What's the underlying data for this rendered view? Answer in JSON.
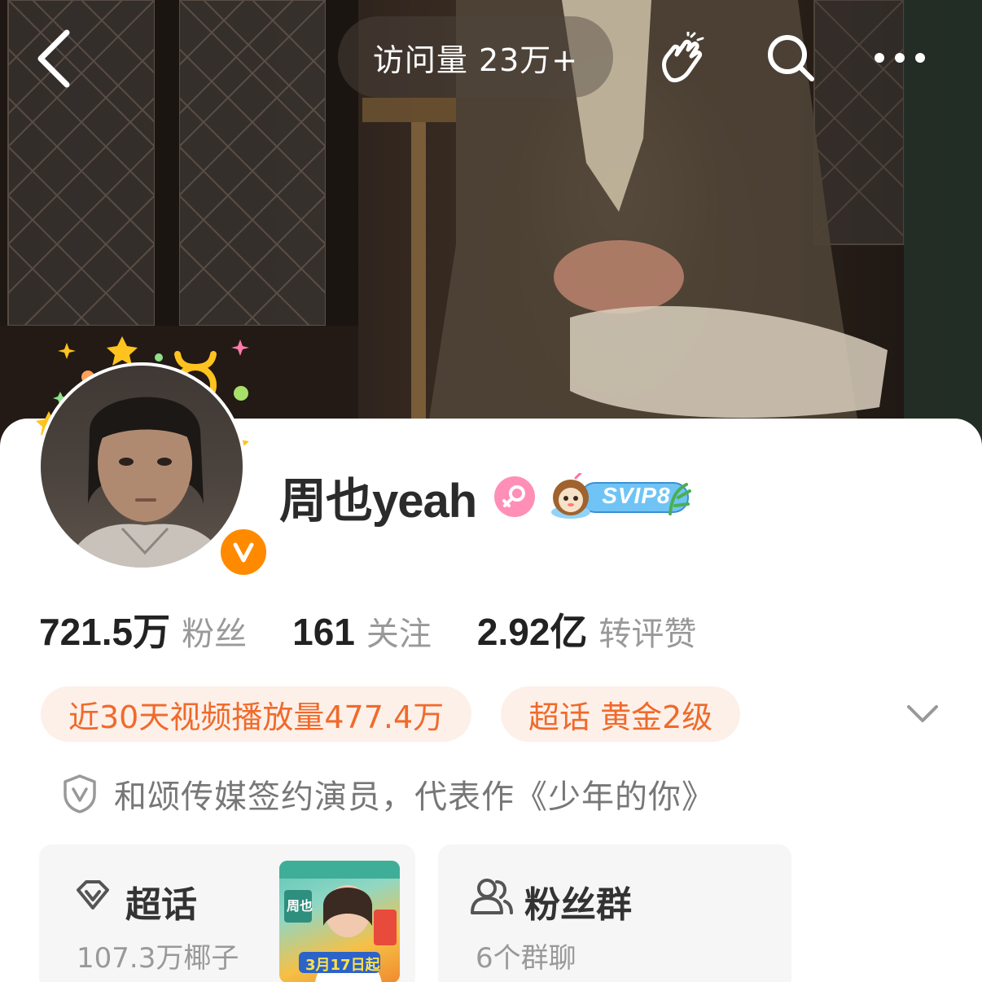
{
  "topbar": {
    "visit_count": "访问量 23万+",
    "back_icon": "chevron-left-icon",
    "greet_icon": "wave-hand-icon",
    "search_icon": "search-icon",
    "more_icon": "more-dots-icon"
  },
  "profile": {
    "name": "周也yeah",
    "gender_icon": "female-icon",
    "verified_icon": "v-verified-icon",
    "svip_label": "SVIP8"
  },
  "stats": [
    {
      "value": "721.5万",
      "label": "粉丝"
    },
    {
      "value": "161",
      "label": "关注"
    },
    {
      "value": "2.92亿",
      "label": "转评赞"
    }
  ],
  "tags": [
    {
      "label": "近30天视频播放量477.4万"
    },
    {
      "label": "超话 黄金2级"
    }
  ],
  "description": "和颂传媒签约演员，代表作《少年的你》",
  "cards": {
    "supertopic": {
      "title": "超话",
      "subtitle": "107.3万椰子"
    },
    "fan_group": {
      "title": "粉丝群",
      "subtitle": "6个群聊"
    }
  },
  "poster": {
    "name_text": "周也",
    "date_text": "3月17日起"
  },
  "colors": {
    "accent_orange": "#f06a2b",
    "tag_bg": "#fdf0e9",
    "verified_orange": "#ff8a00",
    "female_pink": "#ff8fb6"
  }
}
